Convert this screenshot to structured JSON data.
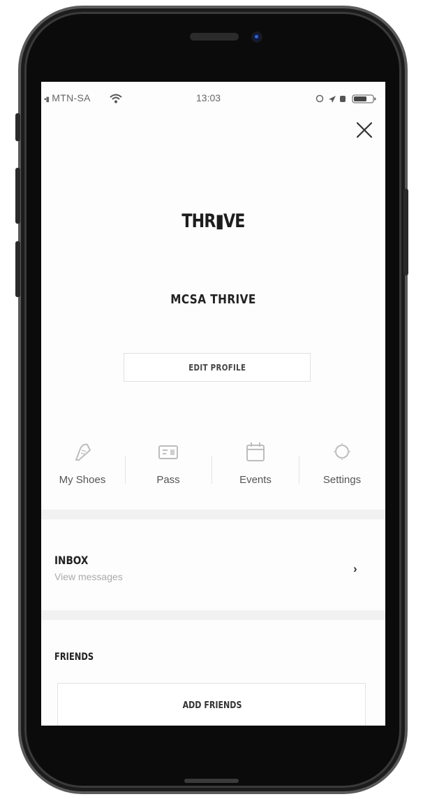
{
  "status_bar": {
    "carrier": "MTN-SA",
    "time": "13:03"
  },
  "icons": {
    "close": "close-icon",
    "wifi": "wifi-icon",
    "shoe": "shoe-icon",
    "pass": "pass-card-icon",
    "events": "calendar-icon",
    "settings": "gear-icon",
    "chevron": "chevron-right-icon"
  },
  "profile": {
    "logo_text": "THR▮VE",
    "name": "MCSA THRIVE",
    "edit_button": "EDIT PROFILE"
  },
  "nav": {
    "items": [
      {
        "label": "My Shoes"
      },
      {
        "label": "Pass"
      },
      {
        "label": "Events"
      },
      {
        "label": "Settings"
      }
    ]
  },
  "inbox": {
    "title": "INBOX",
    "subtitle": "View messages",
    "chevron": "›"
  },
  "friends": {
    "title": "FRIENDS",
    "add_button": "ADD FRIENDS"
  },
  "colors": {
    "text_primary": "#222222",
    "text_muted": "#aaaaaa",
    "divider": "#f1f1f1",
    "icon": "#bdbdbd"
  }
}
